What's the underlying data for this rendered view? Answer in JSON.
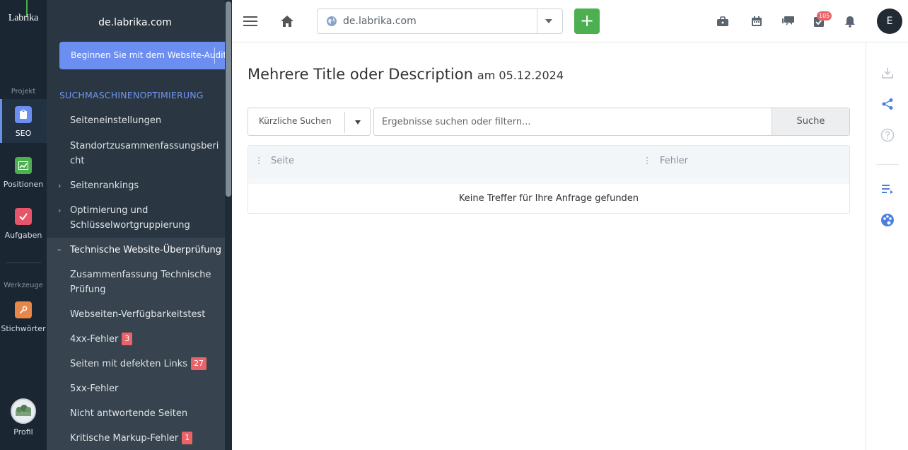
{
  "app": {
    "logo": "Labrika"
  },
  "rail": {
    "project_label": "Projekt",
    "tools_label": "Werkzeuge",
    "items": [
      {
        "label": "SEO",
        "icon": "clipboard-icon",
        "color": "#6b8ef0",
        "active": true
      },
      {
        "label": "Positionen",
        "icon": "chart-icon",
        "color": "#4caf50"
      },
      {
        "label": "Aufgaben",
        "icon": "check-icon",
        "color": "#e8546a"
      },
      {
        "label": "Stichwörter",
        "icon": "key-icon",
        "color": "#e8874a"
      }
    ],
    "profile_label": "Profil"
  },
  "sidebar": {
    "domain": "de.labrika.com",
    "audit_button": "Beginnen Sie mit dem Website-Audit",
    "section_title": "SUCHMASCHINENOPTIMIERUNG",
    "items": [
      {
        "label": "Seiteneinstellungen"
      },
      {
        "label": "Standortzusammenfassungsbericht"
      },
      {
        "label": "Seitenrankings",
        "expandable": true
      },
      {
        "label": "Optimierung und Schlüsselwortgruppierung",
        "expandable": true
      },
      {
        "label": "Technische Website-Überprüfung",
        "expanded": true
      }
    ],
    "sub_items": [
      {
        "label": "Zusammenfassung Technische Prüfung"
      },
      {
        "label": "Webseiten-Verfügbarkeitstest"
      },
      {
        "label": "4xx-Fehler",
        "badge": "3"
      },
      {
        "label": "Seiten mit defekten Links",
        "badge": "27"
      },
      {
        "label": "5xx-Fehler"
      },
      {
        "label": "Nicht antwortende Seiten"
      },
      {
        "label": "Kritische Markup-Fehler",
        "badge": "1"
      }
    ]
  },
  "topbar": {
    "url": "de.labrika.com",
    "add_label": "+",
    "notifications_count": "105",
    "user_initial": "E",
    "icons": [
      "menu-icon",
      "home-icon",
      "briefcase-icon",
      "calendar-icon",
      "chat-icon",
      "tasks-icon",
      "bell-icon"
    ]
  },
  "main": {
    "title": "Mehrere Title oder Description",
    "date": "am 05.12.2024",
    "recent_searches": "Kürzliche Suchen",
    "search_placeholder": "Ergebnisse suchen oder filtern...",
    "search_button": "Suche",
    "columns": [
      "Seite",
      "Fehler"
    ],
    "empty_text": "Keine Treffer für Ihre Anfrage gefunden"
  },
  "right_toolbar": {
    "icons": [
      "download-icon",
      "share-icon",
      "help-icon",
      "list-icon",
      "palette-icon"
    ],
    "accent": "#4a7ee0"
  }
}
